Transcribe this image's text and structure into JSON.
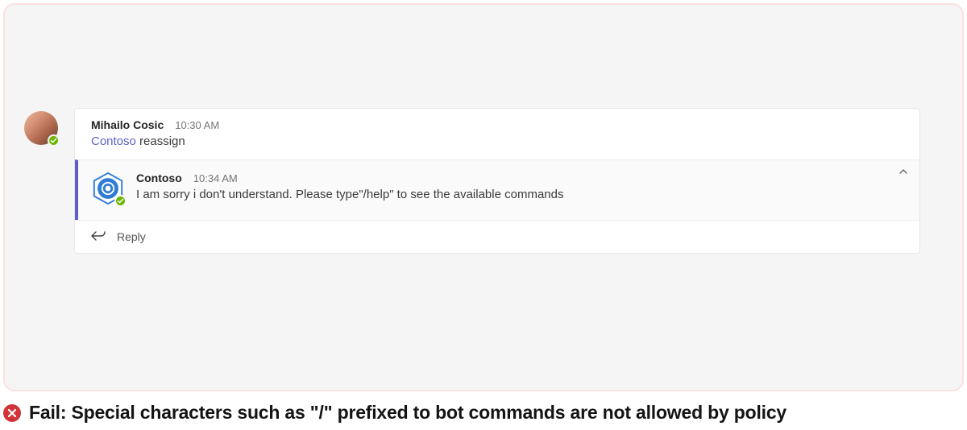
{
  "thread": {
    "root_message": {
      "author": "Mihailo Cosic",
      "time": "10:30 AM",
      "mention": "Contoso",
      "rest": " reassign"
    },
    "reply_message": {
      "author": "Contoso",
      "time": "10:34 AM",
      "body": "I am sorry i don't understand. Please type\"/help\" to see the available commands"
    },
    "reply_box_label": "Reply"
  },
  "status_caption": "Fail: Special characters such as \"/\" prefixed to bot commands are not allowed by policy"
}
